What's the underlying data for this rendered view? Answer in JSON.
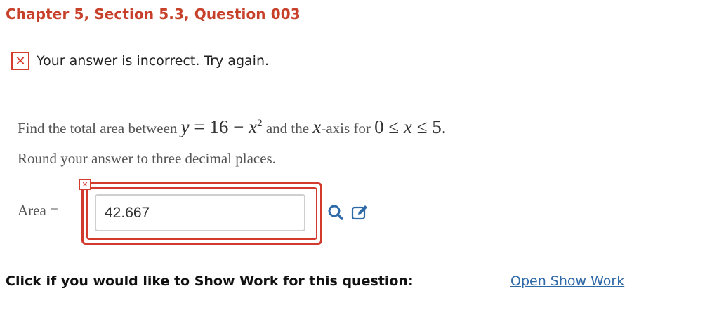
{
  "header": {
    "title": "Chapter 5, Section 5.3, Question 003"
  },
  "feedback": {
    "icon": "incorrect-x-icon",
    "text": "Your answer is incorrect.  Try again."
  },
  "question": {
    "prompt_find": "Find the total area between",
    "eq_y": "y",
    "eq_equals": " = 16 − ",
    "eq_x": "x",
    "eq_exp": "2",
    "prompt_and_the": " and the ",
    "axis_var": "x",
    "prompt_axis_for": "-axis for ",
    "range_lower": "0 ≤ ",
    "range_var": "x",
    "range_upper": " ≤ 5",
    "range_period": ".",
    "round_instruction": "Round your answer to three decimal places."
  },
  "answer": {
    "label": "Area =",
    "value": "42.667",
    "status_icon": "error-x-icon"
  },
  "tools": {
    "search_icon": "magnifier-icon",
    "edit_icon": "pencil-edit-icon",
    "accent_color": "#2e69a8"
  },
  "show_work": {
    "prompt": "Click if you would like to Show Work for this question:",
    "link_label": "Open Show Work"
  },
  "colors": {
    "title": "#c7402a",
    "error": "#d23a2e",
    "link": "#2e69a8"
  }
}
